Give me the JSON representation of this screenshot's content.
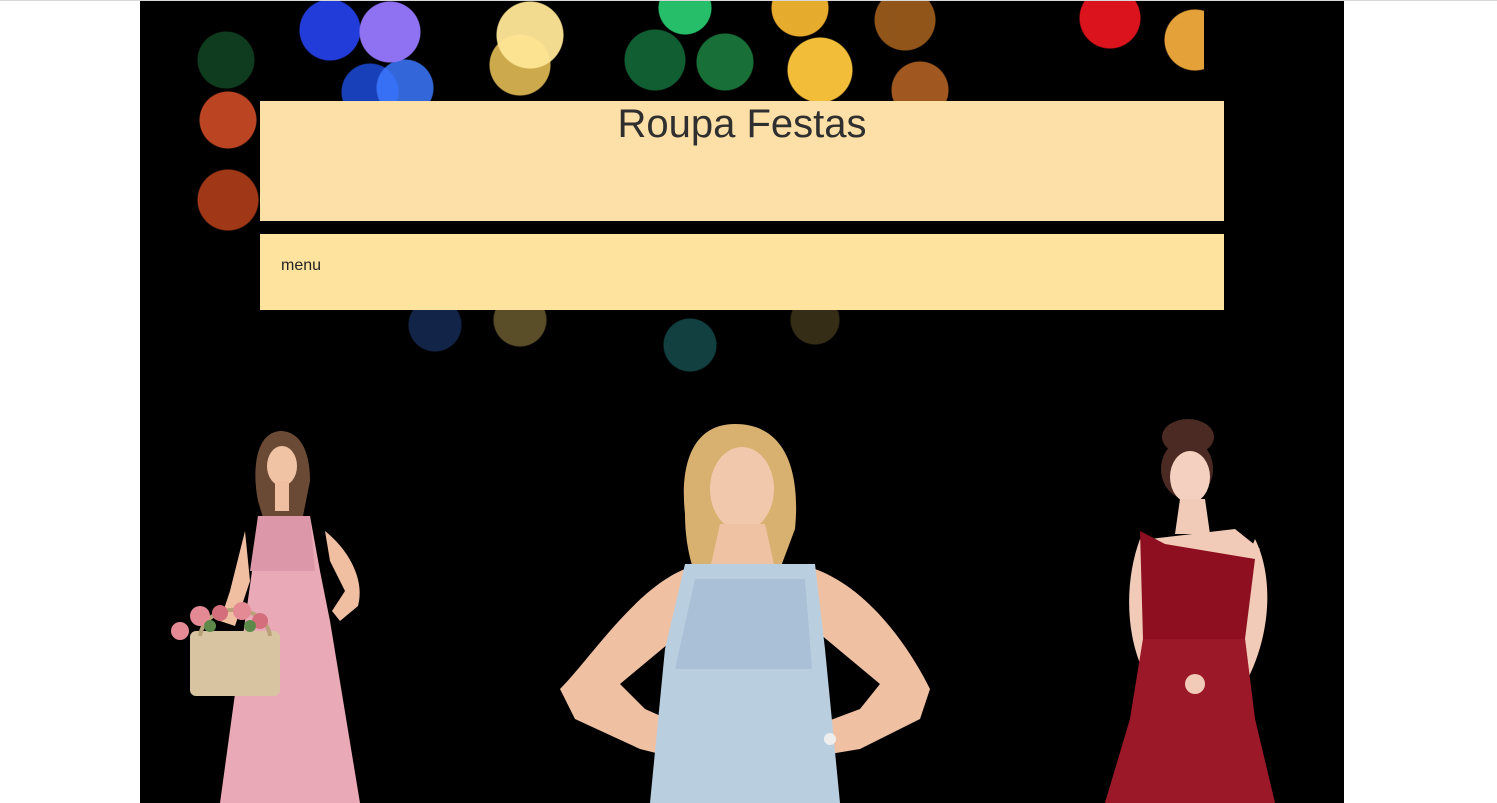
{
  "header": {
    "title": "Roupa Festas"
  },
  "nav": {
    "menu_label": "menu"
  },
  "images": [
    {
      "name": "model-pink-dress-image",
      "dress_color": "#e9a9b6"
    },
    {
      "name": "model-lightblue-dress-image",
      "dress_color": "#b9cfe0"
    },
    {
      "name": "model-red-dress-image",
      "dress_color": "#8e1020"
    }
  ],
  "colors": {
    "header_bg": "#fde0a7",
    "menu_bg": "#fde39d",
    "hero_bg": "#000000"
  }
}
